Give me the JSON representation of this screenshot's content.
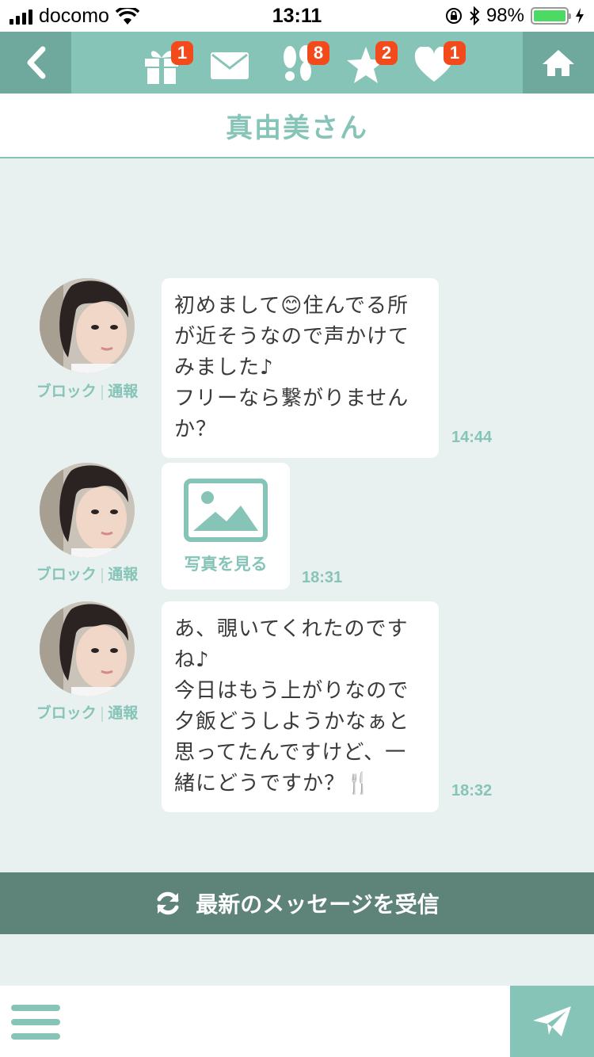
{
  "status_bar": {
    "carrier": "docomo",
    "time": "13:11",
    "battery": "98%"
  },
  "nav": {
    "badges": {
      "gift": "1",
      "footprints": "8",
      "star": "2",
      "heart": "1"
    }
  },
  "title": "真由美さん",
  "messages": [
    {
      "type": "text",
      "text": "初めまして😊住んでる所\nが近そうなので声かけて\nみました♪\nフリーなら繋がりません\nか？",
      "time": "14:44"
    },
    {
      "type": "photo",
      "label": "写真を見る",
      "time": "18:31"
    },
    {
      "type": "text",
      "text": "あ、覗いてくれたのです\nね♪\n今日はもう上がりなので\n夕飯どうしようかなぁと\n思ってたんですけど、一\n緒にどうですか？🍴",
      "time": "18:32"
    }
  ],
  "avatar_links": {
    "block": "ブロック",
    "report": "通報"
  },
  "refresh_label": "最新のメッセージを受信",
  "colors": {
    "accent": "#86c4b8",
    "accent_dark": "#6fa99d",
    "refresh_bar": "#5e847a",
    "badge": "#f34a1c",
    "background": "#e8f1ef"
  }
}
